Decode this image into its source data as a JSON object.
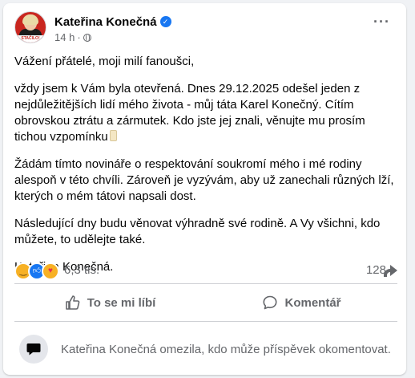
{
  "post": {
    "author": "Kateřina Konečná",
    "verified": true,
    "time": "14 h",
    "time_separator": "·",
    "audience_icon": "globe-icon",
    "avatar_tag": "STAČILO!",
    "paragraphs": [
      "Vážení přátelé, moji milí fanoušci,",
      "vždy jsem k Vám byla otevřená.  Dnes 29.12.2025 odešel jeden z nejdůležitějších lidí mého života - můj táta Karel Konečný. Cítím obrovskou ztrátu a zármutek. Kdo jste jej znali, věnujte mu prosím tichou vzpomínku",
      "Žádám tímto novináře o respektování soukromí mého i mé rodiny alespoň v této chvíli. Zároveň je vyzývám, aby už zanechali různých lží, kterých o mém tátovi napsali dost.",
      "Následující dny budu věnovat výhradně své rodině. A Vy všichni, kdo můžete, to udělejte také.",
      "Kateřina Konečná."
    ]
  },
  "stats": {
    "reactions": [
      "sad",
      "like",
      "care"
    ],
    "reaction_count": "6,3 tis.",
    "share_count": "128"
  },
  "actions": {
    "like_label": "To se mi líbí",
    "comment_label": "Komentář"
  },
  "comment_notice": "Kateřina Konečná omezila, kdo může příspěvek okomentovat.",
  "colors": {
    "accent": "#1877f2",
    "muted_text": "#65676b",
    "background": "#f0f2f5"
  }
}
